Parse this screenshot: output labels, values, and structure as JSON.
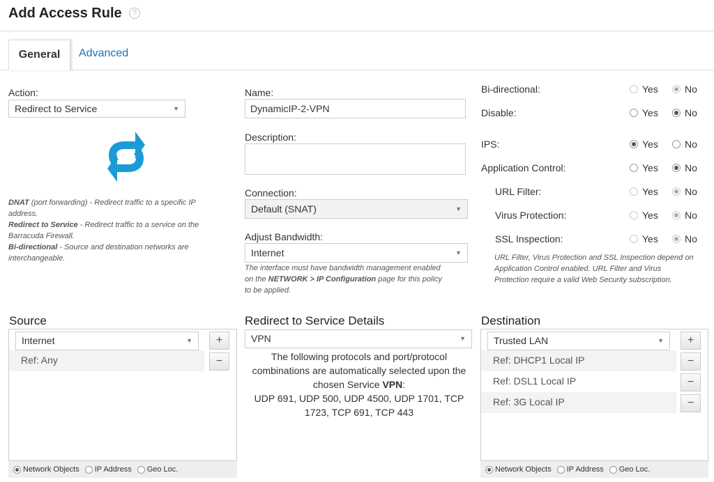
{
  "header": {
    "title": "Add Access Rule",
    "help_glyph": "?"
  },
  "tabs": [
    {
      "label": "General",
      "active": true
    },
    {
      "label": "Advanced",
      "active": false
    }
  ],
  "colors": {
    "accent": "#1a73b8",
    "icon_blue": "#1a9bd7"
  },
  "action": {
    "label": "Action:",
    "value": "Redirect to Service",
    "icon": "redirect-arrows-icon",
    "help": [
      {
        "term": "DNAT",
        "text": " (port forwarding) - Redirect traffic to a specific IP address."
      },
      {
        "term": "Redirect to Service",
        "text": " - Redirect traffic to a service on the Barracuda Firewall."
      },
      {
        "term": "Bi-directional",
        "text": " - Source and destination networks are interchangeable."
      }
    ]
  },
  "name": {
    "label": "Name:",
    "value": "DynamicIP-2-VPN"
  },
  "description": {
    "label": "Description:",
    "value": ""
  },
  "connection": {
    "label": "Connection:",
    "value": "Default (SNAT)"
  },
  "bandwidth": {
    "label": "Adjust Bandwidth:",
    "value": "Internet",
    "note_pre": "The interface must have bandwidth management enabled on the ",
    "note_bold": "NETWORK > IP Configuration",
    "note_post": " page for this policy to be applied."
  },
  "options": {
    "yes_label": "Yes",
    "no_label": "No",
    "rows": [
      {
        "label": "Bi-directional:",
        "value": "No",
        "disabled": true
      },
      {
        "label": "Disable:",
        "value": "No",
        "disabled": false
      },
      {
        "label": "IPS:",
        "value": "Yes",
        "disabled": false
      },
      {
        "label": "Application Control:",
        "value": "No",
        "disabled": false
      },
      {
        "label": "URL Filter:",
        "value": "No",
        "disabled": true
      },
      {
        "label": "Virus Protection:",
        "value": "No",
        "disabled": true
      },
      {
        "label": "SSL Inspection:",
        "value": "No",
        "disabled": true
      }
    ],
    "note": "URL Filter, Virus Protection and SSL Inspection depend on Application Control enabled. URL Filter and Virus Protection require a valid Web Security subscription."
  },
  "source": {
    "heading": "Source",
    "select": "Internet",
    "refs": [
      "Ref: Any"
    ],
    "footer": [
      "Network Objects",
      "IP Address",
      "Geo Loc."
    ],
    "footer_selected": 0
  },
  "redirect": {
    "heading": "Redirect to Service Details",
    "select": "VPN",
    "text_pre": "The following protocols and port/protocol combinations are automatically selected upon the chosen Service ",
    "text_bold": "VPN",
    "text_post": ":",
    "ports": "UDP 691, UDP 500, UDP 4500, UDP 1701, TCP 1723, TCP 691, TCP 443"
  },
  "destination": {
    "heading": "Destination",
    "select": "Trusted LAN",
    "refs": [
      "Ref: DHCP1 Local IP",
      "Ref: DSL1 Local IP",
      "Ref: 3G Local IP"
    ],
    "footer": [
      "Network Objects",
      "IP Address",
      "Geo Loc."
    ],
    "footer_selected": 0
  },
  "buttons": {
    "add": "+",
    "remove": "−"
  }
}
